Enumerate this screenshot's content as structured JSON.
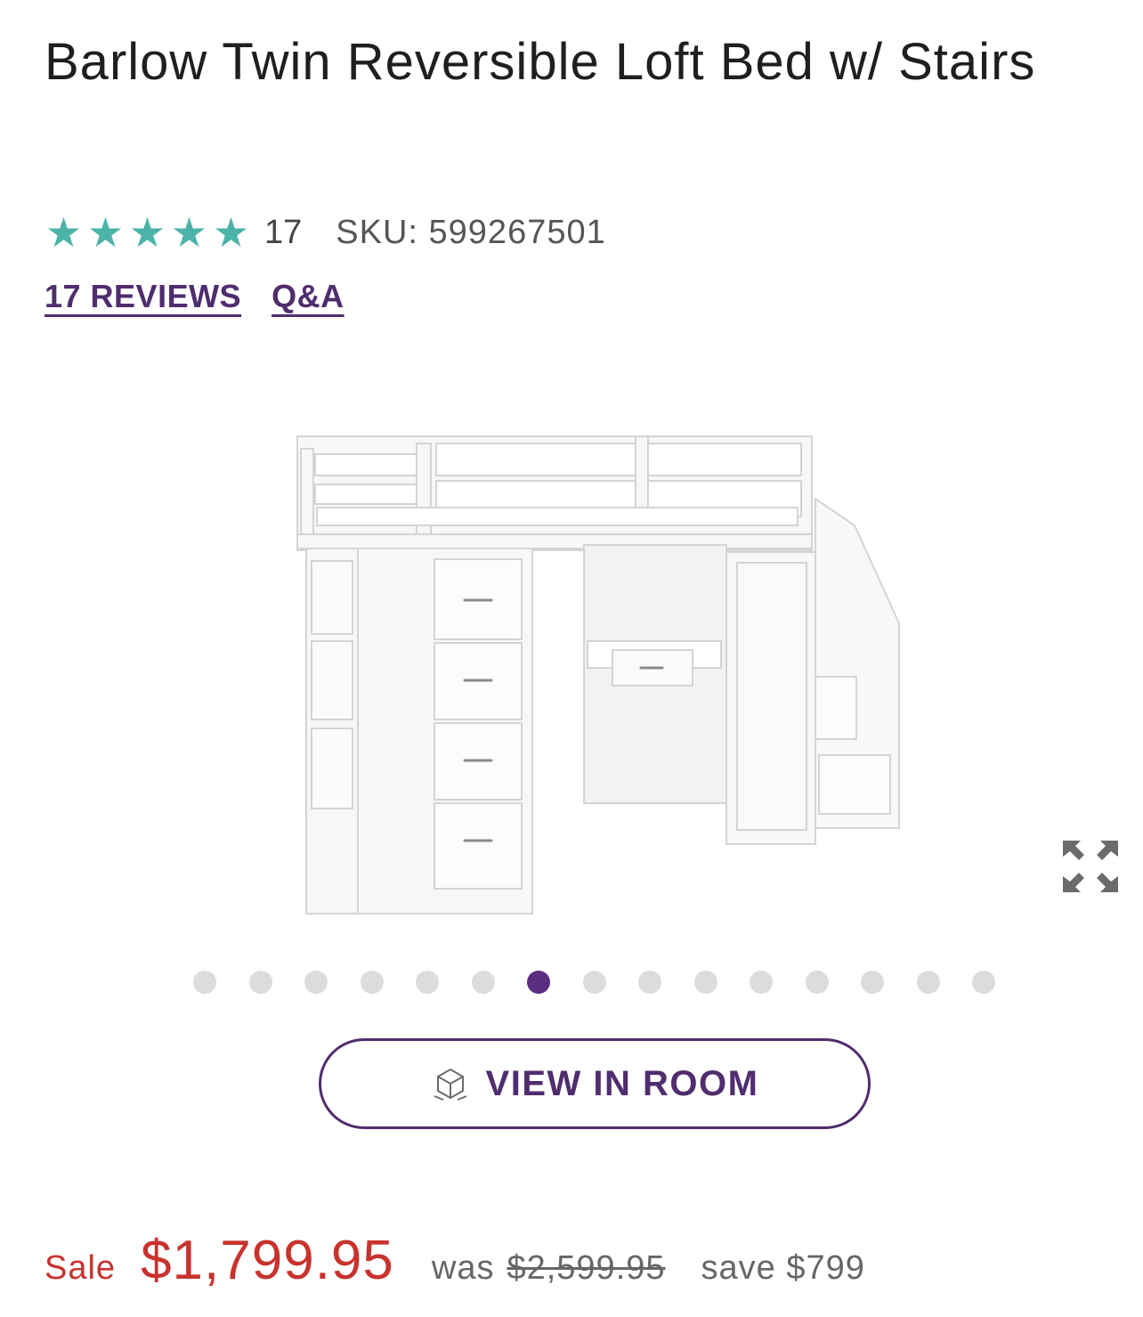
{
  "product": {
    "title": "Barlow Twin Reversible Loft Bed w/ Stairs",
    "rating_value": 5,
    "rating_max": 5,
    "review_count": "17",
    "sku": "SKU: 599267501"
  },
  "links": {
    "reviews": "17 REVIEWS",
    "qa": "Q&A"
  },
  "gallery": {
    "image_count": 15,
    "active_index": 6,
    "expand_icon": "expand-icon"
  },
  "view_in_room": {
    "label": "VIEW IN ROOM",
    "icon": "ar-cube-icon"
  },
  "pricing": {
    "sale_label": "Sale",
    "sale_price": "$1,799.95",
    "was_label": "was",
    "was_price": "$2,599.95",
    "save_text": "save $799"
  },
  "colors": {
    "star": "#4bb3a8",
    "brand_purple": "#4f2d6e",
    "sale_red": "#c8332e"
  }
}
